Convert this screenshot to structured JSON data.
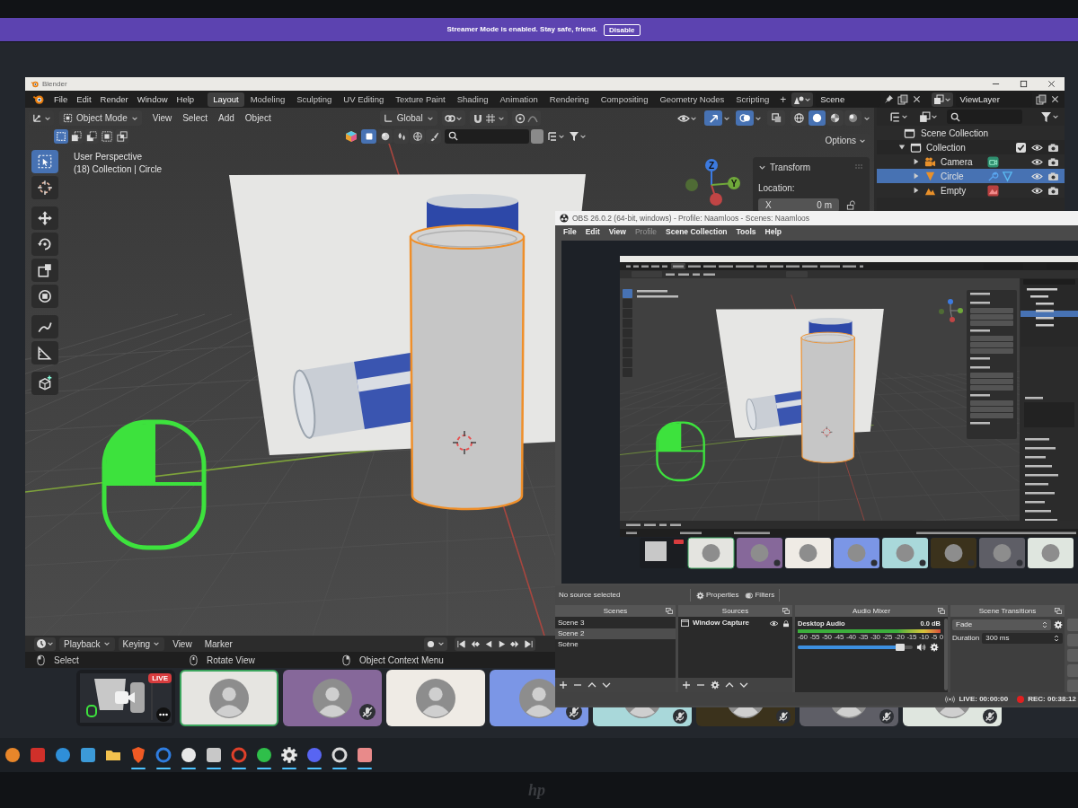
{
  "streamer_banner": {
    "message": "Streamer Mode is enabled. Stay safe, friend.",
    "button": "Disable"
  },
  "blender": {
    "title": "Blender",
    "menu": [
      "File",
      "Edit",
      "Render",
      "Window",
      "Help"
    ],
    "workspaces": [
      {
        "label": "Layout",
        "selected": true
      },
      {
        "label": "Modeling",
        "selected": false
      },
      {
        "label": "Sculpting",
        "selected": false
      },
      {
        "label": "UV Editing",
        "selected": false
      },
      {
        "label": "Texture Paint",
        "selected": false
      },
      {
        "label": "Shading",
        "selected": false
      },
      {
        "label": "Animation",
        "selected": false
      },
      {
        "label": "Rendering",
        "selected": false
      },
      {
        "label": "Compositing",
        "selected": false
      },
      {
        "label": "Geometry Nodes",
        "selected": false
      },
      {
        "label": "Scripting",
        "selected": false
      }
    ],
    "add_workspace": "+",
    "scene": "Scene",
    "view_layer": "ViewLayer",
    "header": {
      "mode": "Object Mode",
      "menus": [
        "View",
        "Select",
        "Add",
        "Object"
      ],
      "orientation": "Global",
      "toggles": [
        {
          "kind": "gizmos",
          "on": true
        },
        {
          "kind": "overlays",
          "on": true
        },
        {
          "kind": "xray",
          "on": false
        }
      ],
      "shading": [
        {
          "kind": "wireframe",
          "selected": false
        },
        {
          "kind": "solid",
          "selected": true
        },
        {
          "kind": "material",
          "selected": false
        },
        {
          "kind": "rendered",
          "selected": false
        }
      ]
    },
    "select_modes": [
      {
        "selected": true
      },
      {
        "selected": false
      },
      {
        "selected": false
      },
      {
        "selected": false
      },
      {
        "selected": false
      }
    ],
    "filters": [
      {
        "kind": "object",
        "selected": true
      },
      {
        "kind": "sphere",
        "selected": false
      },
      {
        "kind": "drops",
        "selected": false
      },
      {
        "kind": "globe",
        "selected": false
      },
      {
        "kind": "brush",
        "selected": false
      }
    ],
    "tools": [
      {
        "kind": "select",
        "selected": true
      },
      {
        "kind": "cursor",
        "selected": false
      },
      {
        "kind": "move",
        "selected": false
      },
      {
        "kind": "rotate",
        "selected": false
      },
      {
        "kind": "scale",
        "selected": false
      },
      {
        "kind": "transform",
        "selected": false
      },
      {
        "kind": "annotate",
        "selected": false
      },
      {
        "kind": "measure",
        "selected": false
      },
      {
        "kind": "addcube",
        "selected": false
      }
    ],
    "viewport": {
      "perspective": "User Perspective",
      "context": "(18) Collection | Circle",
      "options": "Options",
      "gizmo_axes": [
        {
          "kind": "ny"
        },
        {
          "kind": "x"
        },
        {
          "kind": "z",
          "label": "Z"
        },
        {
          "kind": "y",
          "label": "Y"
        }
      ]
    },
    "transform_panel": {
      "title": "Transform",
      "location_label": "Location:",
      "fields": [
        {
          "axis": "X",
          "value": "0 m"
        }
      ]
    },
    "outliner": {
      "root": "Scene Collection",
      "items": [
        {
          "name": "Collection",
          "kind": "collection",
          "expanded": true,
          "checked": true,
          "selected": false,
          "children": [
            {
              "name": "Camera",
              "kind": "camera",
              "expanded": false,
              "selected": false
            },
            {
              "name": "Circle",
              "kind": "mesh",
              "expanded": false,
              "selected": true
            },
            {
              "name": "Empty",
              "kind": "empty",
              "expanded": false,
              "selected": false
            }
          ]
        }
      ]
    },
    "timeline": {
      "menus": [
        {
          "label": "Playback",
          "kind": "dropdown"
        },
        {
          "label": "Keying",
          "kind": "dropdown"
        },
        {
          "label": "View",
          "kind": "menu"
        },
        {
          "label": "Marker",
          "kind": "menu"
        }
      ]
    },
    "status_bar": [
      {
        "label": "Select",
        "kind": "left"
      },
      {
        "label": "Rotate View",
        "kind": "middle"
      },
      {
        "label": "Object Context Menu",
        "kind": "right"
      }
    ]
  },
  "call_tiles": [
    {
      "kind": "stream",
      "badge": "LIVE"
    },
    {
      "kind": "user",
      "color": "#e6e5e1",
      "speaking": true,
      "muted": false
    },
    {
      "kind": "user",
      "color": "#86689a",
      "speaking": false,
      "muted": true
    },
    {
      "kind": "user",
      "color": "#efebe5",
      "speaking": false,
      "muted": false
    },
    {
      "kind": "user",
      "color": "#7b96e6",
      "speaking": false,
      "muted": true
    },
    {
      "kind": "user",
      "color": "#a9d8da",
      "speaking": false,
      "muted": true
    },
    {
      "kind": "user",
      "color": "#3b321c",
      "speaking": false,
      "muted": true
    },
    {
      "kind": "user",
      "color": "#5e5e66",
      "speaking": false,
      "muted": true
    },
    {
      "kind": "user",
      "color": "#dfe6df",
      "speaking": false,
      "muted": true
    }
  ],
  "taskbar": [
    {
      "kind": "orb",
      "color": "#e8862a",
      "running": false
    },
    {
      "kind": "tile",
      "color": "#d0302a",
      "running": false
    },
    {
      "kind": "orb",
      "color": "#2f8fd8",
      "running": false
    },
    {
      "kind": "tile",
      "color": "#3c9ad8",
      "running": false
    },
    {
      "kind": "folder",
      "color": "#f2c14e",
      "running": false
    },
    {
      "kind": "shield",
      "color": "#f05a24",
      "running": true
    },
    {
      "kind": "ring",
      "color": "#2f7de0",
      "running": true
    },
    {
      "kind": "orb",
      "color": "#e8e8e8",
      "running": true
    },
    {
      "kind": "tile",
      "color": "#c8c8c8",
      "running": true
    },
    {
      "kind": "ring",
      "color": "#e0402a",
      "running": true
    },
    {
      "kind": "orb",
      "color": "#2fbf4a",
      "running": true
    },
    {
      "kind": "gear",
      "color": "#e8e8e8",
      "running": true
    },
    {
      "kind": "orb",
      "color": "#5865f2",
      "running": true
    },
    {
      "kind": "ring",
      "color": "#d8d8d8",
      "running": true
    },
    {
      "kind": "tile",
      "color": "#e88a8a",
      "running": true
    }
  ],
  "obs": {
    "title": "OBS 26.0.2 (64-bit, windows) - Profile: Naamloos - Scenes: Naamloos",
    "menu": [
      {
        "label": "File",
        "disabled": false
      },
      {
        "label": "Edit",
        "disabled": false
      },
      {
        "label": "View",
        "disabled": false
      },
      {
        "label": "Profile",
        "disabled": true
      },
      {
        "label": "Scene Collection",
        "disabled": false
      },
      {
        "label": "Tools",
        "disabled": false
      },
      {
        "label": "Help",
        "disabled": false
      }
    ],
    "source_status": "No source selected",
    "properties_button": "Properties",
    "filters_button": "Filters",
    "scenes": {
      "title": "Scenes",
      "items": [
        {
          "label": "Scene 3",
          "selected": false
        },
        {
          "label": "Scene 2",
          "selected": true
        },
        {
          "label": "Scène",
          "selected": false
        }
      ]
    },
    "sources": {
      "title": "Sources",
      "items": [
        {
          "label": "Window Capture"
        }
      ]
    },
    "audio_mixer": {
      "title": "Audio Mixer",
      "channels": [
        {
          "name": "Desktop Audio",
          "reading": "0.0 dB",
          "level": 0.93,
          "ticks": [
            "-60",
            "-55",
            "-50",
            "-45",
            "-40",
            "-35",
            "-30",
            "-25",
            "-20",
            "-15",
            "-10",
            "-5",
            "0"
          ]
        }
      ]
    },
    "scene_transitions": {
      "title": "Scene Transitions",
      "transition": "Fade",
      "duration_label": "Duration",
      "duration": "300 ms"
    },
    "status": {
      "live": "LIVE: 00:00:00",
      "rec": "REC: 00:38:12"
    }
  },
  "monitor": {
    "logo": "hp"
  }
}
